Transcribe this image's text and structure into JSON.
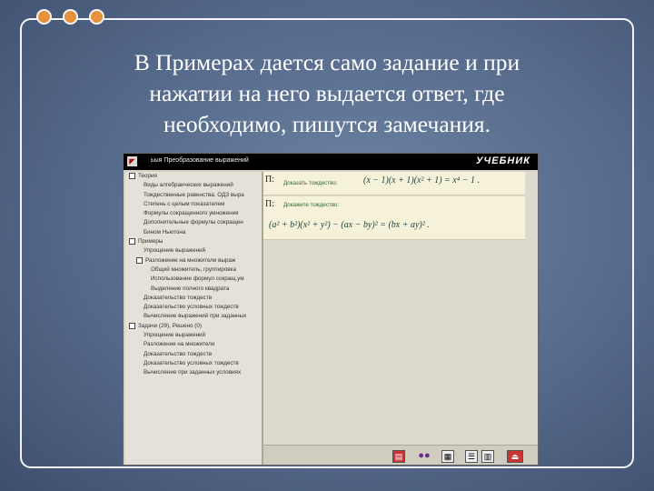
{
  "slide": {
    "line1": "В Примерах дается само задание и при",
    "line2": "нажатии на  него выдается ответ, где",
    "line3": "необходимо, пишутся замечания."
  },
  "colors": {
    "background": "#5f7596",
    "dots": "#e7913d",
    "frame": "#f2f4f8",
    "block_bg": "#f6f2d9",
    "label_green": "#2b6b2b"
  },
  "app": {
    "title": "ьыя  Преобразование выражений",
    "brand": "УЧЕБНИК",
    "tree": [
      {
        "label": "Теория",
        "level": 0,
        "box": "open"
      },
      {
        "label": "Виды алгебраических выражений",
        "level": 2
      },
      {
        "label": "Тождественные равенства. ОДЗ выра",
        "level": 2
      },
      {
        "label": "Степень с целым показателем",
        "level": 2
      },
      {
        "label": "Формулы сокращенного умножения",
        "level": 2
      },
      {
        "label": "Дополнительные формулы сокращен",
        "level": 2
      },
      {
        "label": "Бином Ньютона",
        "level": 2
      },
      {
        "label": "Примеры",
        "level": 0,
        "box": "open"
      },
      {
        "label": "Упрощение выражений",
        "level": 2
      },
      {
        "label": "Разложение на множители выраж",
        "level": 1,
        "box": "open"
      },
      {
        "label": "Общий множитель, группировка",
        "level": 3
      },
      {
        "label": "Использование формул сокращ.ум",
        "level": 3
      },
      {
        "label": "Выделение полного квадрата",
        "level": 3
      },
      {
        "label": "Доказательство тождеств",
        "level": 2
      },
      {
        "label": "Доказательство условных тождеств",
        "level": 2
      },
      {
        "label": "Вычисление выражений при заданных",
        "level": 2
      },
      {
        "label": "Задачи (29), Решено (0)",
        "level": 0,
        "box": "open"
      },
      {
        "label": "Упрощение выражений",
        "level": 2
      },
      {
        "label": "Разложение на множители",
        "level": 2
      },
      {
        "label": "Доказательство тождеств",
        "level": 2
      },
      {
        "label": "Доказательство условных тождеств",
        "level": 2
      },
      {
        "label": "Вычисление при заданных условиях",
        "level": 2
      }
    ],
    "examples": [
      {
        "marker": "П:",
        "label": "Доказать тождество:",
        "formula": "(x − 1)(x + 1)(x² + 1) = x⁴ − 1 ."
      },
      {
        "marker": "П:",
        "label": "Докажите тождество:",
        "formula": "(a² + b²)(x² + y²) − (ax − by)² = (bx + ay)² ."
      }
    ]
  }
}
